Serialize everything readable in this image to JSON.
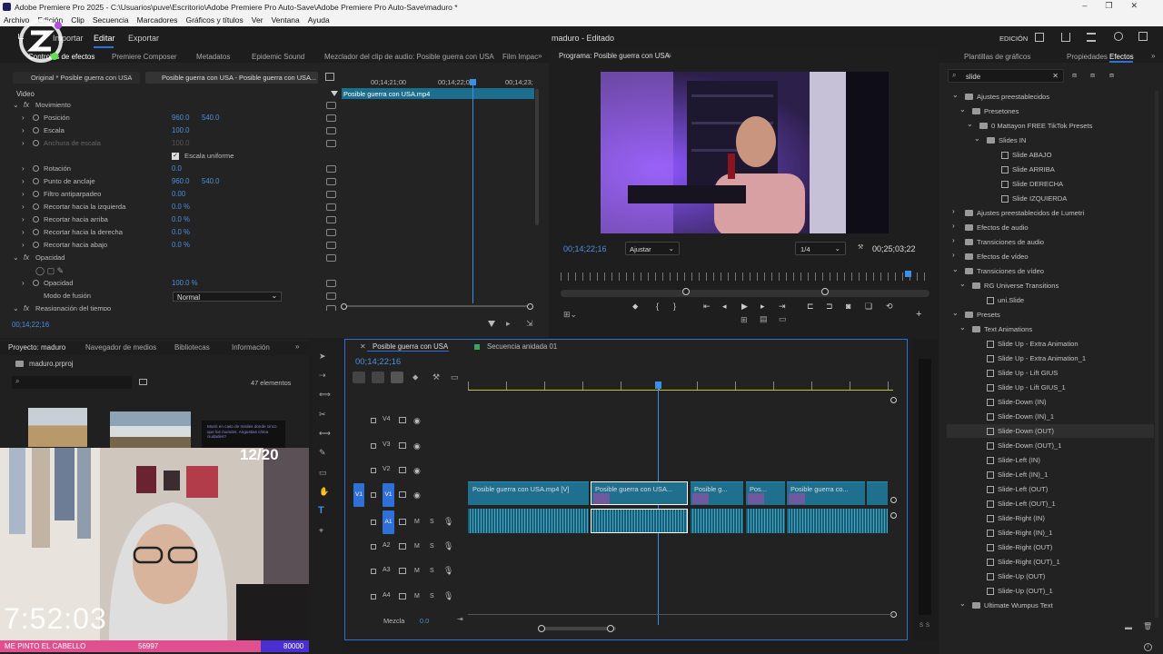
{
  "window": {
    "title": "Adobe Premiere Pro 2025 - C:\\Usuarios\\puve\\Escritorio\\Adobe Premiere Pro Auto-Save\\Adobe Premiere Pro Auto-Save\\maduro *",
    "controls": [
      "–",
      "❐",
      "✕"
    ]
  },
  "menu": [
    "Archivo",
    "Edición",
    "Clip",
    "Secuencia",
    "Marcadores",
    "Gráficos y títulos",
    "Ver",
    "Ventana",
    "Ayuda"
  ],
  "workspace": {
    "tabs": [
      "Importar",
      "Editar",
      "Exportar"
    ],
    "active_tab": "Editar",
    "project_title": "maduro - Editado",
    "mode": "EDICIÓN"
  },
  "effect_controls": {
    "tabs": [
      "Controles de efectos",
      "Premiere Composer",
      "Metadatos",
      "Epidemic Sound",
      "Mezclador del clip de audio: Posible guerra con USA",
      "Film Impac"
    ],
    "source_btn": "Original * Posible guerra con USA",
    "target_btn": "Posible guerra con USA - Posible guerra con USA...",
    "timecodes": [
      "00;14;21;00",
      "00;14;22;00",
      "00;14;23;"
    ],
    "clip_name": "Posible guerra con USA.mp4",
    "section_video": "Video",
    "rows": [
      {
        "indent": 1,
        "fx": true,
        "name": "Movimiento",
        "v1": "",
        "v2": ""
      },
      {
        "indent": 2,
        "name": "Posición",
        "v1": "960.0",
        "v2": "540.0"
      },
      {
        "indent": 2,
        "name": "Escala",
        "v1": "100.0",
        "v2": ""
      },
      {
        "indent": 2,
        "name": "Anchura de escala",
        "v1": "100.0",
        "v2": "",
        "disabled": true
      },
      {
        "indent": 2,
        "name": "Escala uniforme",
        "checkbox": true
      },
      {
        "indent": 2,
        "name": "Rotación",
        "v1": "0.0",
        "v2": ""
      },
      {
        "indent": 2,
        "name": "Punto de anclaje",
        "v1": "960.0",
        "v2": "540.0"
      },
      {
        "indent": 2,
        "name": "Filtro antiparpadeo",
        "v1": "0.00",
        "v2": ""
      },
      {
        "indent": 2,
        "name": "Recortar hacia la izquierda",
        "v1": "0.0 %",
        "v2": ""
      },
      {
        "indent": 2,
        "name": "Recortar hacia arriba",
        "v1": "0.0 %",
        "v2": ""
      },
      {
        "indent": 2,
        "name": "Recortar hacia la derecha",
        "v1": "0.0 %",
        "v2": ""
      },
      {
        "indent": 2,
        "name": "Recortar hacia abajo",
        "v1": "0.0 %",
        "v2": ""
      },
      {
        "indent": 1,
        "fx": true,
        "name": "Opacidad",
        "v1": "",
        "v2": ""
      },
      {
        "indent": 2,
        "name": "masks",
        "masks": true
      },
      {
        "indent": 2,
        "name": "Opacidad",
        "v1": "100.0 %",
        "v2": ""
      },
      {
        "indent": 2,
        "name": "Modo de fusión",
        "select": "Normal"
      },
      {
        "indent": 1,
        "fx": true,
        "name": "Reasignación del tiempo",
        "v1": "",
        "v2": ""
      }
    ],
    "timecode": "00;14;22;16"
  },
  "program": {
    "title": "Programa: Posible guerra con USA",
    "timecode": "00;14;22;16",
    "fit": "Ajustar",
    "resolution": "1/4",
    "duration": "00;25;03;22"
  },
  "project": {
    "tabs": [
      "Proyecto: maduro",
      "Navegador de medios",
      "Bibliotecas",
      "Información"
    ],
    "file": "maduro.prproj",
    "count": "47 elementos",
    "thumb3_text": "Murió en caso de misiles donde cinco que los mundos. Angustias china ciudades?"
  },
  "timeline": {
    "tabs": [
      "Posible guerra con USA",
      "Secuencia anidada 01"
    ],
    "timecode": "00;14;22;16",
    "video_tracks": [
      "V4",
      "V3",
      "V2",
      "V1"
    ],
    "audio_tracks": [
      "A1",
      "A2",
      "A3",
      "A4"
    ],
    "mix_label": "Mezcla",
    "mix_value": "0.0",
    "clips": [
      "Posible guerra con USA.mp4 [V]",
      "Posible guerra con USA...",
      "Posible g...",
      "Pos...",
      "Posible guerra co..."
    ]
  },
  "panels_right": {
    "tabs": [
      "Plantillas de gráficos",
      "Propiedades",
      "Efectos"
    ],
    "search": "slide",
    "tree": [
      {
        "d": 0,
        "open": true,
        "t": "Ajustes preestablecidos",
        "folder": true
      },
      {
        "d": 1,
        "open": true,
        "t": "Presetones",
        "folder": true
      },
      {
        "d": 2,
        "open": true,
        "t": "0 Mattayon FREE TikTok Presets",
        "folder": true
      },
      {
        "d": 3,
        "open": true,
        "t": "Slides IN",
        "folder": true
      },
      {
        "d": 4,
        "t": "Slide ABAJO"
      },
      {
        "d": 4,
        "t": "Slide ARRIBA"
      },
      {
        "d": 4,
        "t": "Slide DERECHA"
      },
      {
        "d": 4,
        "t": "Slide IZQUIERDA"
      },
      {
        "d": 0,
        "open": false,
        "t": "Ajustes preestablecidos de Lumetri",
        "folder": true
      },
      {
        "d": 0,
        "open": false,
        "t": "Efectos de audio",
        "folder": true
      },
      {
        "d": 0,
        "open": false,
        "t": "Transiciones de audio",
        "folder": true
      },
      {
        "d": 0,
        "open": false,
        "t": "Efectos de vídeo",
        "folder": true
      },
      {
        "d": 0,
        "open": true,
        "t": "Transiciones de vídeo",
        "folder": true
      },
      {
        "d": 1,
        "open": true,
        "t": "RG Universe Transitions",
        "folder": true
      },
      {
        "d": 2,
        "t": "uni.Slide"
      },
      {
        "d": 0,
        "open": true,
        "t": "Presets",
        "folder": true
      },
      {
        "d": 1,
        "open": true,
        "t": "Text Animations",
        "folder": true
      },
      {
        "d": 2,
        "t": "Slide Up - Extra Animation"
      },
      {
        "d": 2,
        "t": "Slide Up - Extra Animation_1"
      },
      {
        "d": 2,
        "t": "Slide Up - Lift GIUS"
      },
      {
        "d": 2,
        "t": "Slide Up - Lift GIUS_1"
      },
      {
        "d": 2,
        "t": "Slide-Down (IN)"
      },
      {
        "d": 2,
        "t": "Slide-Down (IN)_1"
      },
      {
        "d": 2,
        "t": "Slide-Down (OUT)",
        "selected": true
      },
      {
        "d": 2,
        "t": "Slide-Down (OUT)_1"
      },
      {
        "d": 2,
        "t": "Slide-Left (IN)"
      },
      {
        "d": 2,
        "t": "Slide-Left (IN)_1"
      },
      {
        "d": 2,
        "t": "Slide-Left (OUT)"
      },
      {
        "d": 2,
        "t": "Slide-Left (OUT)_1"
      },
      {
        "d": 2,
        "t": "Slide-Right (IN)"
      },
      {
        "d": 2,
        "t": "Slide-Right (IN)_1"
      },
      {
        "d": 2,
        "t": "Slide-Right (OUT)"
      },
      {
        "d": 2,
        "t": "Slide-Right (OUT)_1"
      },
      {
        "d": 2,
        "t": "Slide-Up (OUT)"
      },
      {
        "d": 2,
        "t": "Slide-Up (OUT)_1"
      },
      {
        "d": 1,
        "open": true,
        "t": "Ultimate Wumpus Text",
        "folder": true
      }
    ]
  },
  "audio_meter": {
    "labels": [
      "S",
      "S"
    ]
  },
  "overlay": {
    "counter": "12/20",
    "clock": "7:52:03",
    "stream_label": "ME PINTO EL CABELLO",
    "points": "56997",
    "goal": "80000"
  },
  "colors": {
    "accent": "#2f6fd8",
    "clip": "#1f6f8f",
    "bar_pink": "#e04f8f",
    "bar_purple": "#4b2fd3"
  }
}
